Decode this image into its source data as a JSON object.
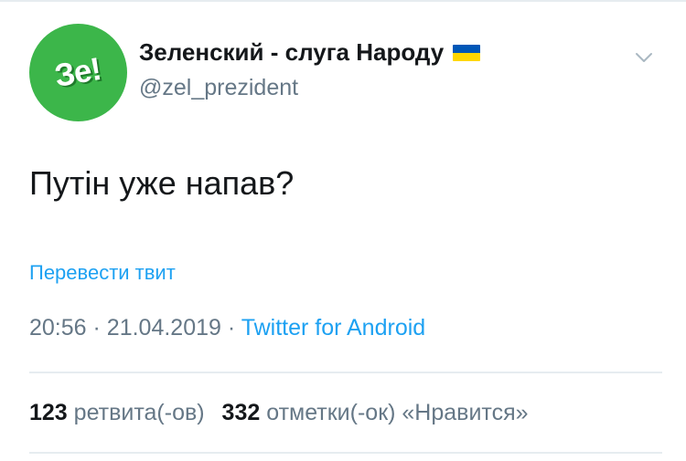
{
  "profile": {
    "avatar_text": "Зе!",
    "display_name": "Зеленский - слуга Народу",
    "handle": "@zel_prezident"
  },
  "tweet": {
    "text": "Путін уже напав?",
    "translate_label": "Перевести твит"
  },
  "meta": {
    "time": "20:56",
    "separator": "·",
    "date": "21.04.2019",
    "source": "Twitter for Android"
  },
  "stats": {
    "retweets_count": "123",
    "retweets_label": "ретвита(-ов)",
    "likes_count": "332",
    "likes_label": "отметки(-ок) «Нравится»"
  },
  "colors": {
    "accent": "#1da1f2",
    "avatar_green": "#3cb64a",
    "secondary_text": "#657786",
    "flag_blue": "#0057b7",
    "flag_yellow": "#ffd700"
  },
  "icons": {
    "menu": "chevron-down-icon",
    "flag": "ukraine-flag-icon"
  }
}
